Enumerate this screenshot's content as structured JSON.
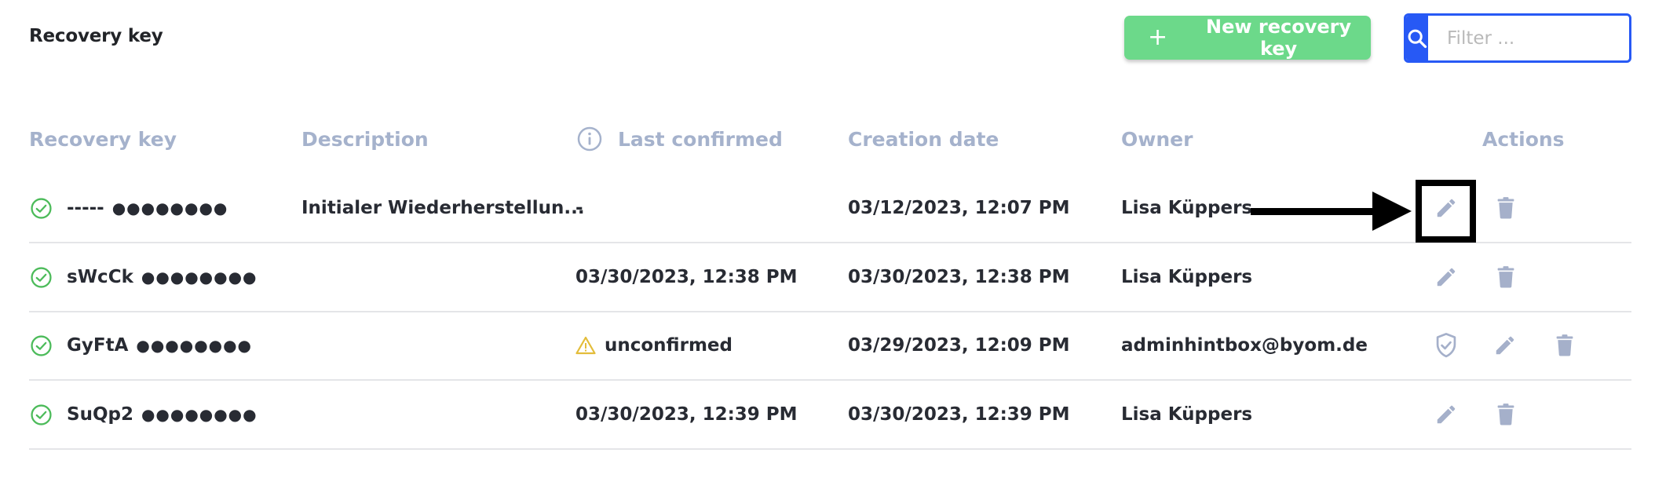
{
  "header": {
    "title": "Recovery key",
    "new_button_label": "New recovery key",
    "new_button_icon": "plus-icon",
    "filter_placeholder": "Filter ...",
    "filter_value": "",
    "filter_icon": "search-icon"
  },
  "colors": {
    "primary_green": "#6cd98a",
    "primary_blue": "#2759f5",
    "header_text": "#a5b2cc",
    "action_icon": "#a5b0ca",
    "status_ok": "#4cbb5a",
    "warning": "#e3bd3a"
  },
  "table": {
    "columns": [
      {
        "label": "Recovery key"
      },
      {
        "label": "Description"
      },
      {
        "label": "Last confirmed",
        "icon": "info-icon"
      },
      {
        "label": "Creation date"
      },
      {
        "label": "Owner"
      },
      {
        "label": "Actions"
      }
    ],
    "rows": [
      {
        "status_icon": "check-circle-icon",
        "key_prefix": "-----",
        "key_mask": "●●●●●●●●",
        "description": "Initialer Wiederherstellun...",
        "last_confirmed": "-",
        "creation_date": "03/12/2023, 12:07 PM",
        "owner": "Lisa Küppers",
        "actions": [
          "edit",
          "delete"
        ]
      },
      {
        "status_icon": "check-circle-icon",
        "key_prefix": "sWcCk",
        "key_mask": "●●●●●●●●",
        "description": "",
        "last_confirmed": "03/30/2023, 12:38 PM",
        "creation_date": "03/30/2023, 12:38 PM",
        "owner": "Lisa Küppers",
        "actions": [
          "edit",
          "delete"
        ]
      },
      {
        "status_icon": "check-circle-icon",
        "key_prefix": "GyFtA",
        "key_mask": "●●●●●●●●",
        "description": "",
        "last_confirmed": "unconfirmed",
        "last_confirmed_icon": "warning-icon",
        "creation_date": "03/29/2023, 12:09 PM",
        "owner": "adminhintbox@byom.de",
        "actions": [
          "confirm",
          "edit",
          "delete"
        ]
      },
      {
        "status_icon": "check-circle-icon",
        "key_prefix": "SuQp2",
        "key_mask": "●●●●●●●●",
        "description": "",
        "last_confirmed": "03/30/2023, 12:39 PM",
        "creation_date": "03/30/2023, 12:39 PM",
        "owner": "Lisa Küppers",
        "actions": [
          "edit",
          "delete"
        ]
      }
    ]
  },
  "annotation": {
    "type": "arrow-with-box",
    "target": "row-1-edit-button"
  }
}
